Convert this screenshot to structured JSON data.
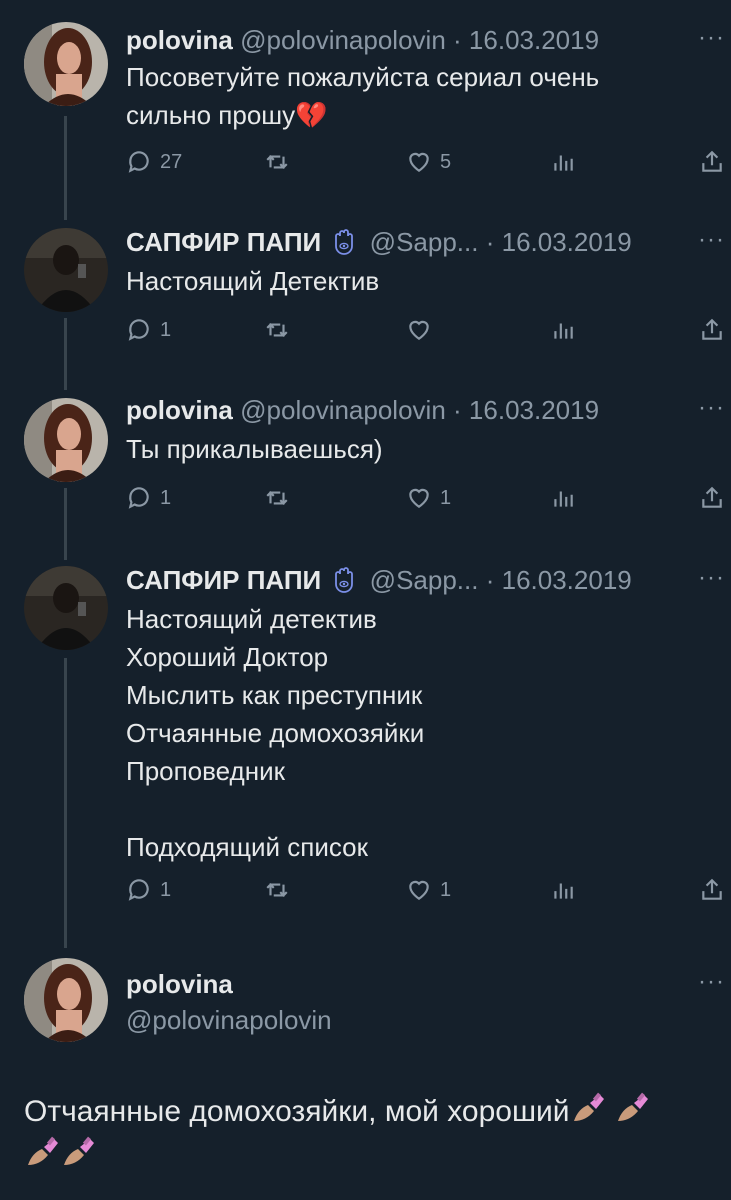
{
  "tweets": [
    {
      "name": "polovina",
      "handle": "@polovinapolovin",
      "sep": "·",
      "date": "16.03.2019",
      "more": "···",
      "text": "Посоветуйте пожалуйста сериал очень\nсильно прошу💔",
      "replies": "27",
      "retweets": "",
      "likes": "5"
    },
    {
      "name": "САПФИР ПАПИ",
      "handle": "@Sapp...",
      "sep": "·",
      "date": "16.03.2019",
      "more": "···",
      "text": "Настоящий Детектив",
      "replies": "1",
      "retweets": "",
      "likes": ""
    },
    {
      "name": "polovina",
      "handle": "@polovinapolovin",
      "sep": "·",
      "date": "16.03.2019",
      "more": "···",
      "text": "Ты прикалываешься)",
      "replies": "1",
      "retweets": "",
      "likes": "1"
    },
    {
      "name": "САПФИР ПАПИ",
      "handle": "@Sapp...",
      "sep": "·",
      "date": "16.03.2019",
      "more": "···",
      "text": "Настоящий детектив\nХороший Доктор\nМыслить как преступник\nОтчаянные домохозяйки\nПроповедник\n\nПодходящий список",
      "replies": "1",
      "retweets": "",
      "likes": "1"
    }
  ],
  "main": {
    "name": "polovina",
    "handle": "@polovinapolovin",
    "more": "···",
    "text": "Отчаянные домохозяйки, мой хороший"
  },
  "colors": {
    "background": "#15202b",
    "text": "#e7e9ea",
    "muted": "#8b98a5",
    "line": "#38444d",
    "verified": "#7b8fe8"
  }
}
